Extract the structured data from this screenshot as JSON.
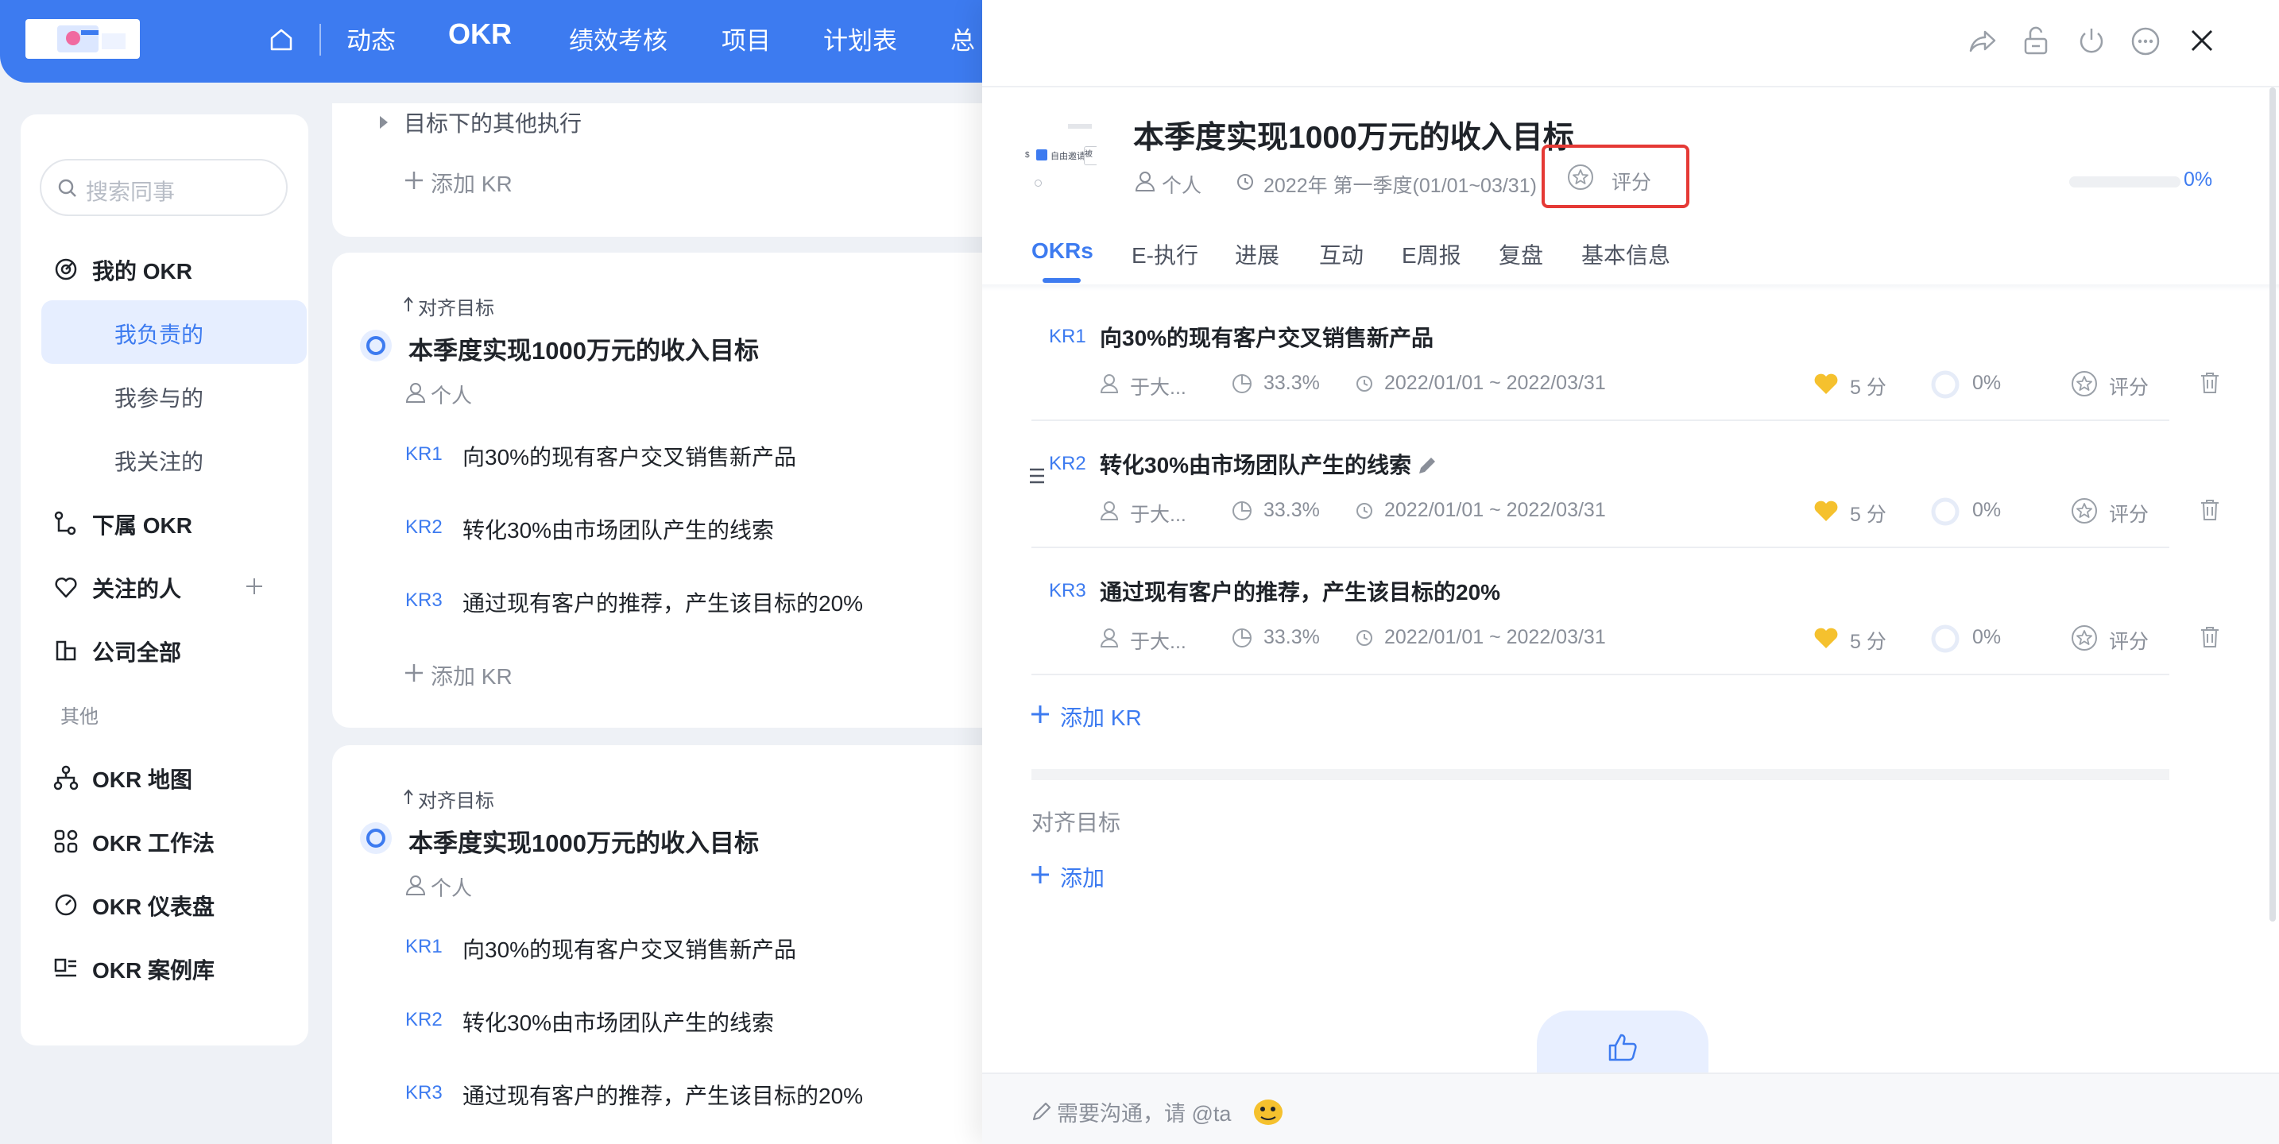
{
  "topnav": {
    "items": [
      "动态",
      "OKR",
      "绩效考核",
      "项目",
      "计划表",
      "总"
    ]
  },
  "sidebar": {
    "search_placeholder": "搜索同事",
    "my_okr": "我的 OKR",
    "sub": [
      "我负责的",
      "我参与的",
      "我关注的"
    ],
    "sub_okr": "下属 OKR",
    "followed": "关注的人",
    "company": "公司全部",
    "other_label": "其他",
    "others": [
      "OKR 地图",
      "OKR 工作法",
      "OKR 仪表盘",
      "OKR 案例库"
    ]
  },
  "main": {
    "prev_card": {
      "collapsed_text": "目标下的其他执行",
      "add_kr": "添加 KR"
    },
    "cards": [
      {
        "align_label": "对齐目标",
        "title": "本季度实现1000万元的收入目标",
        "owner": "个人",
        "krs": [
          {
            "tag": "KR1",
            "text": "向30%的现有客户交叉销售新产品"
          },
          {
            "tag": "KR2",
            "text": "转化30%由市场团队产生的线索"
          },
          {
            "tag": "KR3",
            "text": "通过现有客户的推荐，产生该目标的20%"
          }
        ],
        "add_kr": "添加 KR"
      },
      {
        "align_label": "对齐目标",
        "title": "本季度实现1000万元的收入目标",
        "owner": "个人",
        "krs": [
          {
            "tag": "KR1",
            "text": "向30%的现有客户交叉销售新产品"
          },
          {
            "tag": "KR2",
            "text": "转化30%由市场团队产生的线索"
          },
          {
            "tag": "KR3",
            "text": "通过现有客户的推荐，产生该目标的20%"
          }
        ]
      }
    ]
  },
  "panel": {
    "title": "本季度实现1000万元的收入目标",
    "owner": "个人",
    "period": "2022年 第一季度(01/01~03/31)",
    "score_label": "评分",
    "progress": "0%",
    "thumb_texts": {
      "left": "自由邀请",
      "right": "被"
    },
    "tabs": [
      "OKRs",
      "E-执行",
      "进展",
      "互动",
      "E周报",
      "复盘",
      "基本信息"
    ],
    "active_tab": "OKRs",
    "krs": [
      {
        "tag": "KR1",
        "title": "向30%的现有客户交叉销售新产品",
        "owner": "于大...",
        "weight": "33.3%",
        "dates": "2022/01/01 ~ 2022/03/31",
        "confidence": "5 分",
        "progress": "0%",
        "score": "评分"
      },
      {
        "tag": "KR2",
        "title": "转化30%由市场团队产生的线索",
        "owner": "于大...",
        "weight": "33.3%",
        "dates": "2022/01/01 ~ 2022/03/31",
        "confidence": "5 分",
        "progress": "0%",
        "score": "评分"
      },
      {
        "tag": "KR3",
        "title": "通过现有客户的推荐，产生该目标的20%",
        "owner": "于大...",
        "weight": "33.3%",
        "dates": "2022/01/01 ~ 2022/03/31",
        "confidence": "5 分",
        "progress": "0%",
        "score": "评分"
      }
    ],
    "add_kr": "添加 KR",
    "align_section": "对齐目标",
    "add": "添加",
    "comment_placeholder": "需要沟通，请 @ta"
  },
  "colors": {
    "accent": "#3d7bf0",
    "highlight_box": "#e53935",
    "confidence": "#f5c12e"
  }
}
